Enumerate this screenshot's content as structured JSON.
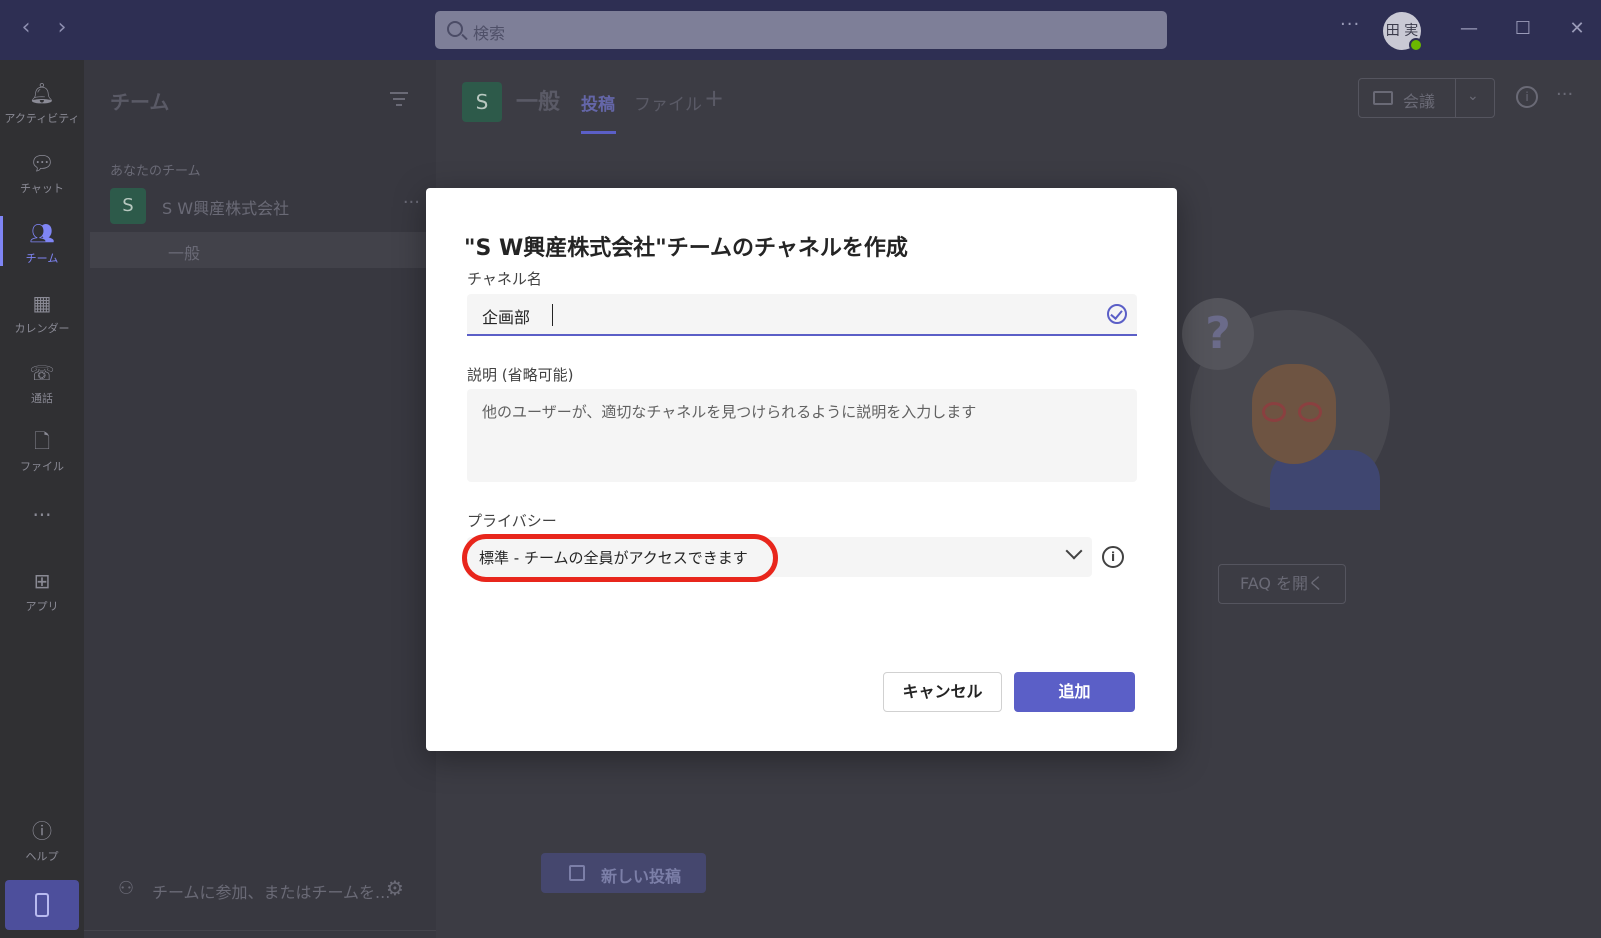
{
  "titlebar": {
    "back_icon": "chevron-left-icon",
    "forward_icon": "chevron-right-icon",
    "search_placeholder": "検索",
    "more": "···",
    "avatar_initials": "田 実"
  },
  "rail": {
    "items": [
      {
        "label": "アクティビティ",
        "icon": "bell-icon"
      },
      {
        "label": "チャット",
        "icon": "chat-icon"
      },
      {
        "label": "チーム",
        "icon": "teams-icon"
      },
      {
        "label": "カレンダー",
        "icon": "calendar-icon"
      },
      {
        "label": "通話",
        "icon": "phone-icon"
      },
      {
        "label": "ファイル",
        "icon": "file-icon"
      },
      {
        "label": "···",
        "icon": "more-icon"
      },
      {
        "label": "アプリ",
        "icon": "apps-icon"
      },
      {
        "label": "ヘルプ",
        "icon": "help-icon"
      }
    ],
    "active_index": 2
  },
  "teampane": {
    "title": "チーム",
    "section_label": "あなたのチーム",
    "team_initial": "S",
    "team_name": "S W興産株式会社",
    "team_more": "···",
    "channel_name": "一般",
    "join_text": "チームに参加、またはチームを..."
  },
  "channel": {
    "initial": "S",
    "name": "一般",
    "tabs": [
      "投稿",
      "ファイル"
    ],
    "active_tab": 0,
    "add": "+",
    "meet_label": "会議",
    "more": "···"
  },
  "empty_state": {
    "faq_label": "FAQ を開く",
    "new_post_label": "新しい投稿",
    "bubble_text": "?"
  },
  "dialog": {
    "title": "\"S W興産株式会社\"チームのチャネルを作成",
    "channel_name_label": "チャネル名",
    "channel_name_value": "企画部",
    "description_label": "説明 (省略可能)",
    "description_placeholder": "他のユーザーが、適切なチャネルを見つけられるように説明を入力します",
    "privacy_label": "プライバシー",
    "privacy_value": "標準 - チームの全員がアクセスできます",
    "cancel_label": "キャンセル",
    "add_label": "追加",
    "accent_color": "#5b5fc7",
    "highlight_color": "#e8261c"
  }
}
